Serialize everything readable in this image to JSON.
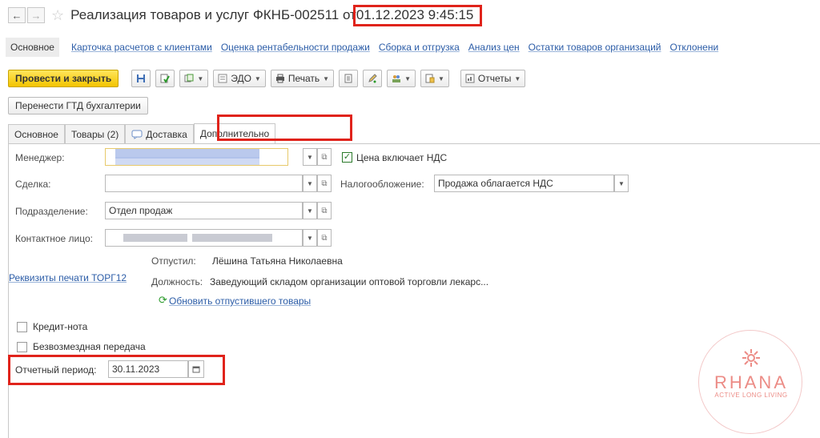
{
  "titlebar": {
    "back": "←",
    "forward": "→",
    "title": "Реализация товаров и услуг ФКНБ-002511 от",
    "date": "01.12.2023 9:45:15"
  },
  "panel": {
    "items": [
      "Основное",
      "Карточка расчетов с клиентами",
      "Оценка рентабельности продажи",
      "Сборка и отгрузка",
      "Анализ цен",
      "Остатки товаров организаций",
      "Отклонени"
    ]
  },
  "toolbar": {
    "post_close": "Провести и закрыть",
    "edo": "ЭДО",
    "print": "Печать",
    "reports": "Отчеты",
    "transfer_gtd": "Перенести ГТД бухгалтерии"
  },
  "tabs": [
    "Основное",
    "Товары (2)",
    "Доставка",
    "Дополнительно"
  ],
  "form": {
    "manager_label": "Менеджер:",
    "price_includes_vat": "Цена включает НДС",
    "deal_label": "Сделка:",
    "taxation_label": "Налогообложение:",
    "taxation_value": "Продажа облагается НДС",
    "department_label": "Подразделение:",
    "department_value": "Отдел продаж",
    "contact_label": "Контактное лицо:",
    "released_label": "Отпустил:",
    "released_value": "Лёшина Татьяна Николаевна",
    "torg12_link": "Реквизиты печати ТОРГ12",
    "position_label": "Должность:",
    "position_value": "Заведующий складом организации оптовой торговли лекарс...",
    "update_link": "Обновить отпустившего товары",
    "credit_note": "Кредит-нота",
    "free_transfer": "Безвозмездная передача",
    "period_label": "Отчетный период:",
    "period_value": "30.11.2023"
  },
  "logo": {
    "word": "RHANA",
    "sub": "ACTIVE LONG LIVING"
  }
}
